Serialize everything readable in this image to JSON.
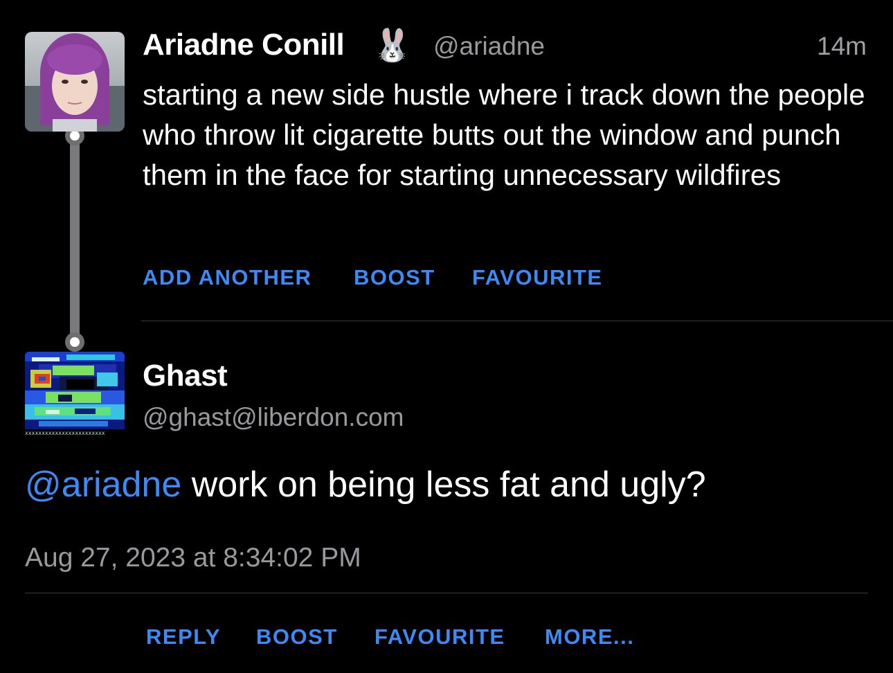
{
  "parent_post": {
    "display_name": "Ariadne Conill",
    "emoji": "🐰",
    "handle": "@ariadne",
    "time": "14m",
    "text": "starting a new side hustle where i track down the people who throw lit cigarette butts out the window and punch them in the face for starting unnecessary wildfires",
    "actions": {
      "add_another": "ADD ANOTHER",
      "boost": "BOOST",
      "favourite": "FAVOURITE"
    }
  },
  "main_post": {
    "display_name": "Ghast",
    "handle": "@ghast@liberdon.com",
    "mention": "@ariadne",
    "text": " work on being less fat and ugly?",
    "timestamp": "Aug 27, 2023 at 8:34:02 PM",
    "actions": {
      "reply": "REPLY",
      "boost": "BOOST",
      "favourite": "FAVOURITE",
      "more": "MORE..."
    },
    "avatar_pattern_text": "xxxxxxxxxxxxxxxxxxxxxxxx"
  },
  "colors": {
    "background": "#000000",
    "accent": "#3d8af7",
    "secondary_text": "#9a9a9e",
    "divider": "#3a3a3c",
    "thread_line": "#7a7a7c"
  }
}
